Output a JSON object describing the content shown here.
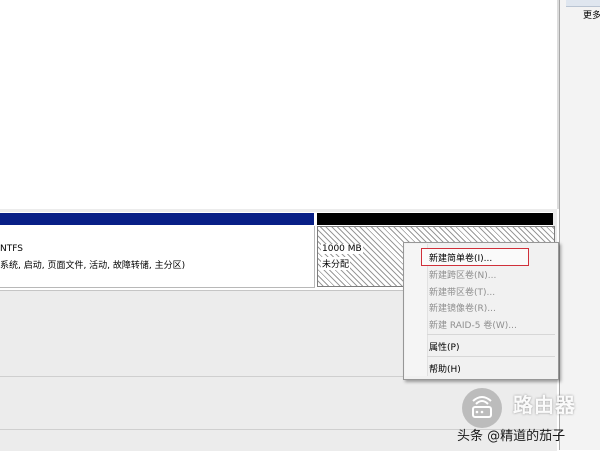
{
  "right_pane": {
    "more_label": "更多"
  },
  "disk": {
    "primary_partition": {
      "filesystem": "NTFS",
      "status": "系统, 启动, 页面文件, 活动, 故障转储, 主分区)"
    },
    "unallocated": {
      "size": "1000 MB",
      "label": "未分配"
    }
  },
  "context_menu": {
    "items": [
      {
        "label": "新建简单卷(I)...",
        "enabled": true
      },
      {
        "label": "新建跨区卷(N)...",
        "enabled": false
      },
      {
        "label": "新建带区卷(T)...",
        "enabled": false
      },
      {
        "label": "新建镜像卷(R)...",
        "enabled": false
      },
      {
        "label": "新建 RAID-5 卷(W)...",
        "enabled": false
      },
      {
        "label": "属性(P)",
        "enabled": true
      },
      {
        "label": "帮助(H)",
        "enabled": true
      }
    ]
  },
  "watermark": {
    "brand": "路由器",
    "author": "头条 @精道的茄子",
    "icon": "router-logo-icon"
  },
  "colors": {
    "partition_bar_primary": "#081f86",
    "partition_bar_unallocated": "#000000",
    "highlight_border": "#d0303a"
  }
}
